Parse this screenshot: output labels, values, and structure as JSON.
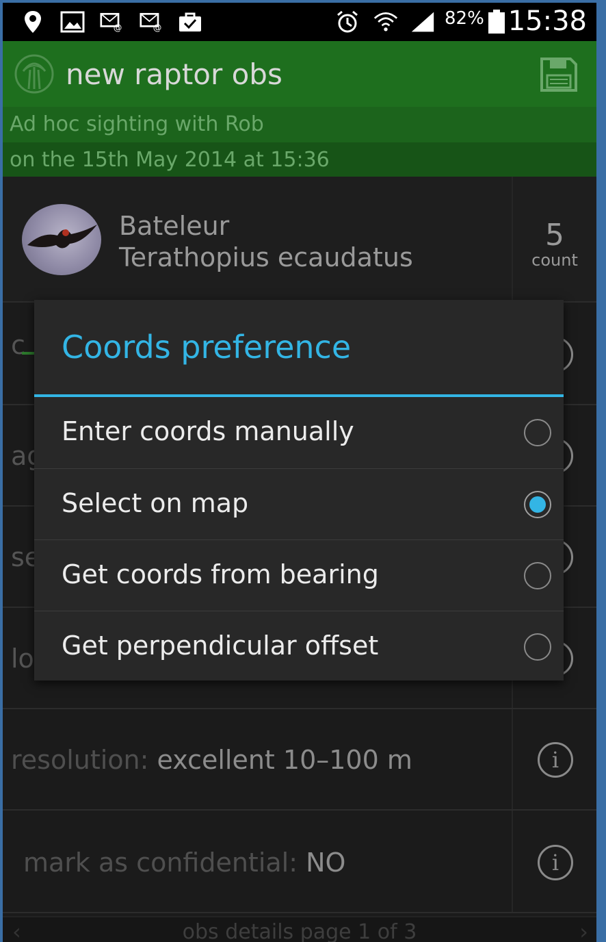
{
  "status_bar": {
    "battery": "82%",
    "clock": "15:38"
  },
  "action_bar": {
    "title": "new raptor obs"
  },
  "subtitle": {
    "line1": "Ad hoc sighting with Rob",
    "line2": "on the 15th May 2014 at 15:36"
  },
  "species": {
    "common_name": "Bateleur",
    "latin_name": "Terathopius ecaudatus",
    "count_value": "5",
    "count_label": "count"
  },
  "rows": {
    "row2_stub": "c",
    "row3_stub": "ag",
    "row4_stub": "se",
    "row5_stub": "lo",
    "resolution_label": "resolution:",
    "resolution_value": "excellent 10–100 m",
    "confidential_label": "mark as confidential:",
    "confidential_value": "NO",
    "info_glyph": "i"
  },
  "bottom_nav": {
    "text": "obs details page 1 of 3",
    "prev": "‹",
    "next": "›"
  },
  "dialog": {
    "title": "Coords preference",
    "options": [
      {
        "label": "Enter coords manually",
        "checked": false
      },
      {
        "label": "Select on map",
        "checked": true
      },
      {
        "label": "Get coords from bearing",
        "checked": false
      },
      {
        "label": "Get perpendicular offset",
        "checked": false
      }
    ]
  },
  "colors": {
    "accent": "#33b5e5",
    "actionbar": "#1e6f1e",
    "frame": "#3a6ea5"
  }
}
